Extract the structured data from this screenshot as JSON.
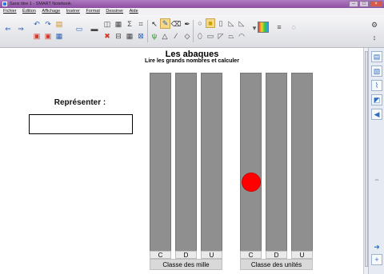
{
  "window": {
    "title": "Sans titre 1 - SMART Notebook"
  },
  "menu": [
    "Fichier",
    "Édition",
    "Affichage",
    "Insérer",
    "Format",
    "Dessiner",
    "Aide"
  ],
  "page": {
    "title": "Les abaques",
    "subtitle": "Lire les grands nombres et calculer",
    "represent_label": "Représenter :",
    "represent_value": ""
  },
  "abacus": {
    "groups": [
      {
        "label": "Classe des mille",
        "columns": [
          "C",
          "D",
          "U"
        ]
      },
      {
        "label": "Classe des unités",
        "columns": [
          "C",
          "D",
          "U"
        ]
      }
    ],
    "beads": [
      {
        "group": "Classe des unités",
        "column": "C",
        "count": 1,
        "color": "#ff0000"
      }
    ]
  },
  "colors": {
    "rod": "#8f8f8f",
    "bead": "#ff0000",
    "accent": "#2a5fb5"
  }
}
